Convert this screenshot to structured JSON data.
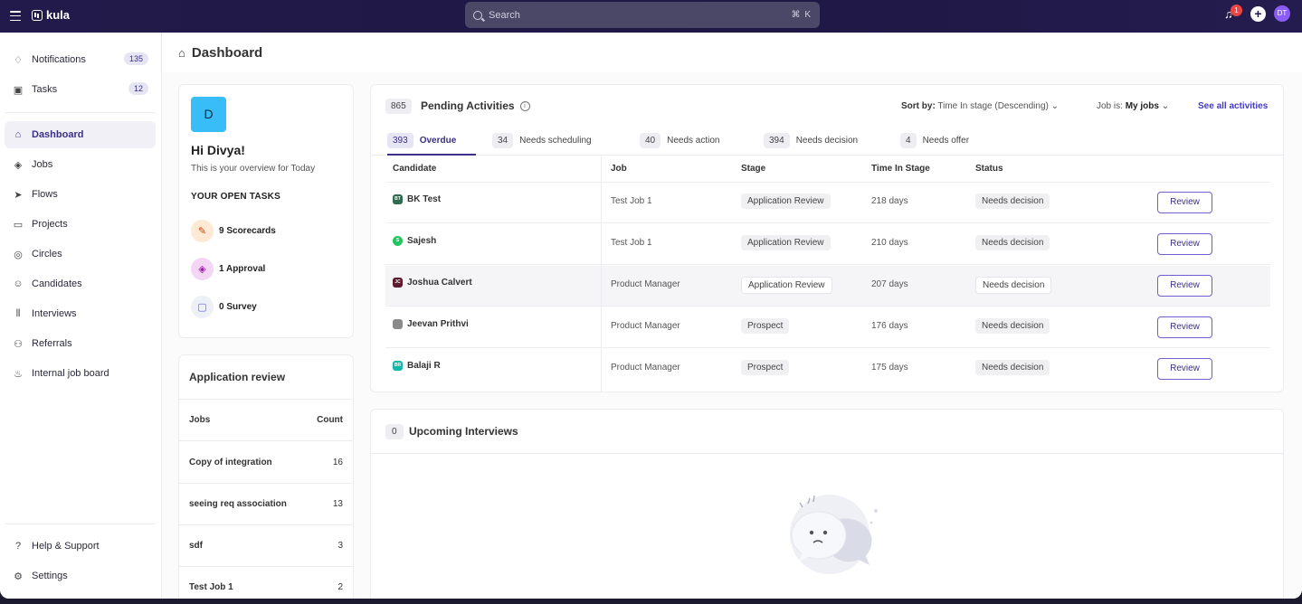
{
  "app": {
    "brand": "kula"
  },
  "search": {
    "placeholder": "Search",
    "shortcut": "⌘ K"
  },
  "topbar": {
    "notification_badge": "1",
    "avatar_initials": "DT"
  },
  "sidebar": {
    "items": [
      {
        "label": "Notifications",
        "count": "135",
        "icon": "bell-icon"
      },
      {
        "label": "Tasks",
        "count": "12",
        "icon": "calendar-icon"
      },
      {
        "label": "Dashboard",
        "icon": "home-icon",
        "active": true
      },
      {
        "label": "Jobs",
        "icon": "layers-icon"
      },
      {
        "label": "Flows",
        "icon": "send-icon"
      },
      {
        "label": "Projects",
        "icon": "folder-icon"
      },
      {
        "label": "Circles",
        "icon": "circles-icon"
      },
      {
        "label": "Candidates",
        "icon": "user-circle-icon"
      },
      {
        "label": "Interviews",
        "icon": "waveform-icon"
      },
      {
        "label": "Referrals",
        "icon": "user-plus-icon"
      },
      {
        "label": "Internal job board",
        "icon": "board-icon"
      }
    ],
    "bottom": [
      {
        "label": "Help & Support",
        "icon": "help-icon"
      },
      {
        "label": "Settings",
        "icon": "gear-icon"
      }
    ]
  },
  "header": {
    "title": "Dashboard"
  },
  "greeting": {
    "initial": "D",
    "hello": "Hi Divya!",
    "subtitle": "This is your overview for Today",
    "open_tasks_title": "YOUR OPEN TASKS",
    "tasks": [
      {
        "label": "9 Scorecards",
        "icon": "pencil-icon",
        "color": "#fde9d4"
      },
      {
        "label": "1 Approval",
        "icon": "stack-icon",
        "color": "#f3d6f3"
      },
      {
        "label": "0 Survey",
        "icon": "chat-icon",
        "color": "#eef0f8"
      }
    ]
  },
  "app_review": {
    "title": "Application review",
    "col_jobs": "Jobs",
    "col_count": "Count",
    "rows": [
      {
        "job": "Copy of integration",
        "count": "16"
      },
      {
        "job": "seeing req association",
        "count": "13"
      },
      {
        "job": "sdf",
        "count": "3"
      },
      {
        "job": "Test Job 1",
        "count": "2"
      }
    ]
  },
  "pending": {
    "count": "865",
    "title": "Pending Activities",
    "sort_label": "Sort by:",
    "sort_value": "Time In stage (Descending)",
    "jobis_label": "Job is:",
    "jobis_value": "My jobs",
    "see_all": "See all activities",
    "tabs": [
      {
        "count": "393",
        "label": "Overdue",
        "active": true
      },
      {
        "count": "34",
        "label": "Needs scheduling"
      },
      {
        "count": "40",
        "label": "Needs action"
      },
      {
        "count": "394",
        "label": "Needs decision"
      },
      {
        "count": "4",
        "label": "Needs offer"
      }
    ],
    "columns": {
      "candidate": "Candidate",
      "job": "Job",
      "stage": "Stage",
      "time": "Time In Stage",
      "status": "Status"
    },
    "rows": [
      {
        "initials": "BT",
        "avatar_color": "#2f6b4f",
        "name": "BK Test",
        "job": "Test Job 1",
        "stage": "Application Review",
        "time": "218 days",
        "status": "Needs decision",
        "action": "Review"
      },
      {
        "initials": "S",
        "avatar_color": "#22c55e",
        "name": "Sajesh",
        "job": "Test Job 1",
        "stage": "Application Review",
        "time": "210 days",
        "status": "Needs decision",
        "action": "Review"
      },
      {
        "initials": "JC",
        "avatar_color": "#5b1a2e",
        "name": "Joshua Calvert",
        "job": "Product Manager",
        "stage": "Application Review",
        "time": "207 days",
        "status": "Needs decision",
        "action": "Review",
        "highlight": true
      },
      {
        "initials": "",
        "avatar_color": "#8a8a8a",
        "name": "Jeevan Prithvi",
        "job": "Product Manager",
        "stage": "Prospect",
        "time": "176 days",
        "status": "Needs decision",
        "action": "Review"
      },
      {
        "initials": "BR",
        "avatar_color": "#14b8a6",
        "name": "Balaji R",
        "job": "Product Manager",
        "stage": "Prospect",
        "time": "175 days",
        "status": "Needs decision",
        "action": "Review"
      }
    ]
  },
  "upcoming": {
    "count": "0",
    "title": "Upcoming Interviews"
  }
}
